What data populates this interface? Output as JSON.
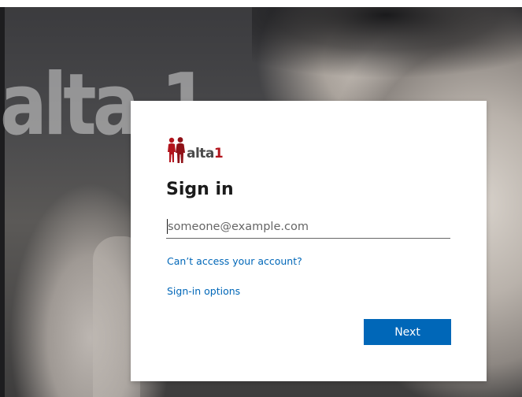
{
  "background": {
    "logo_text": "alta-1"
  },
  "brand": {
    "word_main": "alta",
    "word_accent": "1",
    "accent_color": "#b3151d"
  },
  "signin": {
    "title": "Sign in",
    "email_placeholder": "someone@example.com",
    "email_value": "",
    "cant_access_link": "Can’t access your account?",
    "options_link": "Sign-in options",
    "next_label": "Next"
  },
  "colors": {
    "link": "#0067b8",
    "primary_button": "#0067b8"
  }
}
